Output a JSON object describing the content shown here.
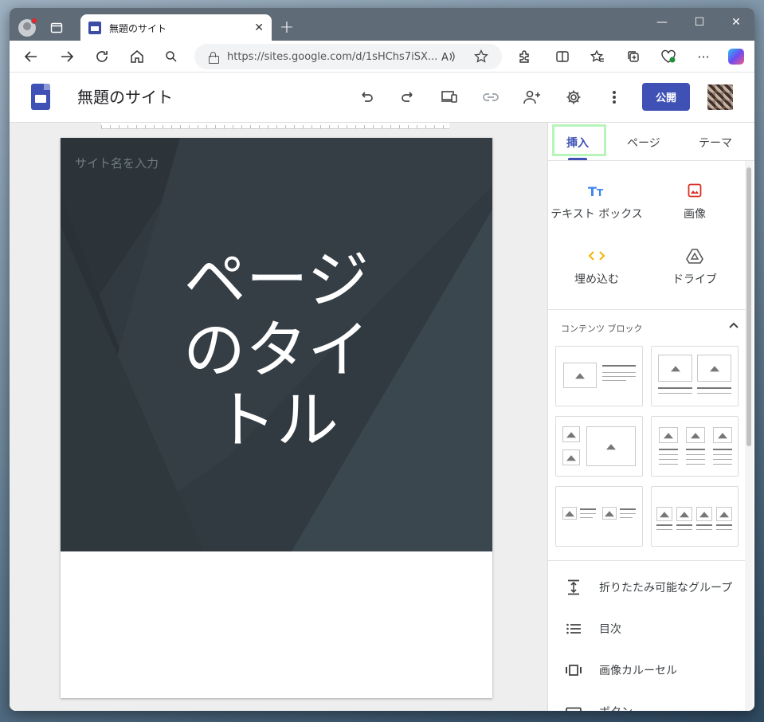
{
  "browser": {
    "tab_title": "無題のサイト",
    "tab_close": "✕",
    "new_tab": "+",
    "url": "https://sites.google.com/d/1sHChs7iSX...",
    "read_aloud": "Ȃ",
    "more": "···"
  },
  "window_controls": {
    "minimize": "—",
    "maximize": "☐",
    "close": "✕"
  },
  "app": {
    "site_title": "無題のサイト",
    "publish_label": "公開"
  },
  "page": {
    "site_name_placeholder": "サイト名を入力",
    "title_line1": "ページ",
    "title_line2": "のタイ",
    "title_line3": "トル"
  },
  "panel": {
    "tabs": {
      "insert": "挿入",
      "pages": "ページ",
      "themes": "テーマ"
    },
    "insert_items": {
      "textbox": "テキスト ボックス",
      "image": "画像",
      "embed": "埋め込む",
      "drive": "ドライブ"
    },
    "content_blocks_label": "コンテンツ ブロック",
    "components": {
      "collapsible": "折りたたみ可能なグループ",
      "toc": "目次",
      "carousel": "画像カルーセル",
      "button": "ボタン"
    }
  },
  "colors": {
    "accent": "#3f51b5",
    "hero_bg": "#303a40",
    "insert_tab_highlight": "#b8f5b8",
    "image_icon": "#d93025",
    "embed_icon": "#f4b400"
  }
}
